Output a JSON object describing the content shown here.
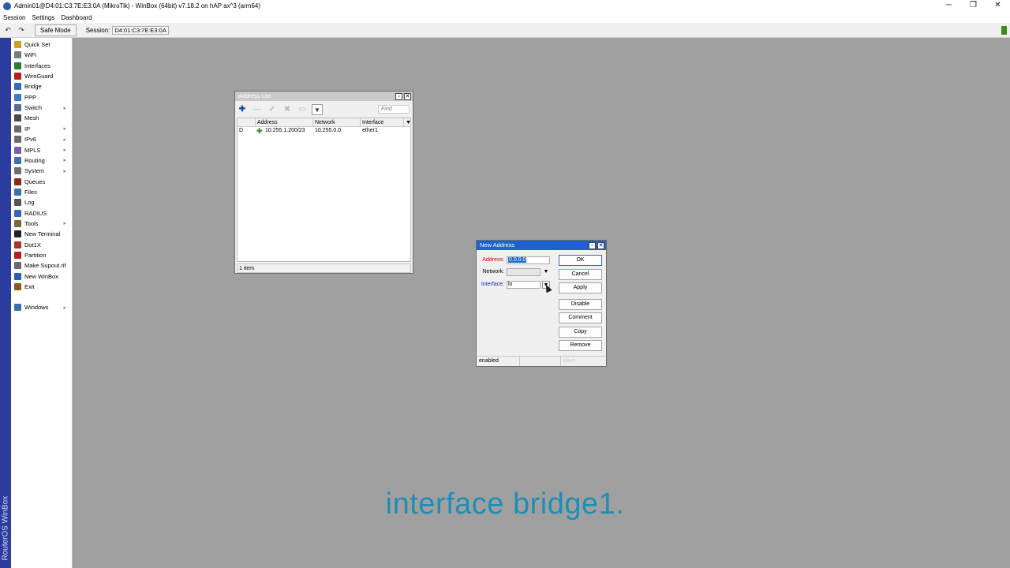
{
  "window": {
    "title": "Admin01@D4:01:C3:7E:E3:0A (MikroTik) - WinBox (64bit) v7.18.2 on hAP ax^3 (arm64)",
    "min_glyph": "─",
    "max_glyph": "❐",
    "close_glyph": "✕"
  },
  "menu": [
    "Session",
    "Settings",
    "Dashboard"
  ],
  "toolbar": {
    "undo_glyph": "↶",
    "redo_glyph": "↷",
    "safe_mode_label": "Safe Mode",
    "session_label": "Session:",
    "session_value": "D4:01:C3:7E:E3:0A"
  },
  "brand_vertical": "RouterOS WinBox",
  "sidebar": {
    "items": [
      {
        "label": "Quick Set",
        "icon": "quick-set-icon",
        "color": "#c9a227",
        "submenu": false
      },
      {
        "label": "WiFi",
        "icon": "wifi-icon",
        "color": "#7a7a7a",
        "submenu": false
      },
      {
        "label": "Interfaces",
        "icon": "interfaces-icon",
        "color": "#2e7d32",
        "submenu": false
      },
      {
        "label": "WireGuard",
        "icon": "wireguard-icon",
        "color": "#b0231a",
        "submenu": false
      },
      {
        "label": "Bridge",
        "icon": "bridge-icon",
        "color": "#2e6fb5",
        "submenu": false
      },
      {
        "label": "PPP",
        "icon": "ppp-icon",
        "color": "#3c7cc2",
        "submenu": false
      },
      {
        "label": "Switch",
        "icon": "switch-icon",
        "color": "#5a6e8a",
        "submenu": true
      },
      {
        "label": "Mesh",
        "icon": "mesh-icon",
        "color": "#4a4a4a",
        "submenu": false
      },
      {
        "label": "IP",
        "icon": "ip-icon",
        "color": "#6b6b6b",
        "submenu": true
      },
      {
        "label": "IPv6",
        "icon": "ipv6-icon",
        "color": "#6b6b6b",
        "submenu": true
      },
      {
        "label": "MPLS",
        "icon": "mpls-icon",
        "color": "#7b5ea7",
        "submenu": true
      },
      {
        "label": "Routing",
        "icon": "routing-icon",
        "color": "#3e6fae",
        "submenu": true
      },
      {
        "label": "System",
        "icon": "system-icon",
        "color": "#6e6e6e",
        "submenu": true
      },
      {
        "label": "Queues",
        "icon": "queues-icon",
        "color": "#8a2a1c",
        "submenu": false
      },
      {
        "label": "Files",
        "icon": "files-icon",
        "color": "#3a6fb0",
        "submenu": false
      },
      {
        "label": "Log",
        "icon": "log-icon",
        "color": "#555555",
        "submenu": false
      },
      {
        "label": "RADIUS",
        "icon": "radius-icon",
        "color": "#3b63b8",
        "submenu": false
      },
      {
        "label": "Tools",
        "icon": "tools-icon",
        "color": "#7a6a3a",
        "submenu": true
      },
      {
        "label": "New Terminal",
        "icon": "terminal-icon",
        "color": "#222222",
        "submenu": false
      },
      {
        "label": "Dot1X",
        "icon": "dot1x-icon",
        "color": "#b03030",
        "submenu": false
      },
      {
        "label": "Partition",
        "icon": "partition-icon",
        "color": "#b01e1e",
        "submenu": false
      },
      {
        "label": "Make Supout.rif",
        "icon": "supout-icon",
        "color": "#6a6a6a",
        "submenu": false
      },
      {
        "label": "New WinBox",
        "icon": "winbox-icon",
        "color": "#2a5ea8",
        "submenu": false
      },
      {
        "label": "Exit",
        "icon": "exit-icon",
        "color": "#8a5a1e",
        "submenu": false
      }
    ],
    "windows": {
      "label": "Windows",
      "icon": "windows-icon",
      "color": "#3a6fb0",
      "submenu": true
    }
  },
  "address_list": {
    "title": "Address List",
    "find_placeholder": "Find",
    "filter_glyph": "▼",
    "add_glyph": "✚",
    "remove_glyph": "—",
    "enable_glyph": "✔",
    "disable_glyph": "✖",
    "comment_glyph": "▭",
    "columns": [
      "Address",
      "Network",
      "Interface"
    ],
    "rows": [
      {
        "flag": "D",
        "address": "10.255.1.200/23",
        "network": "10.255.0.0",
        "interface": "ether1"
      }
    ],
    "status": "1 item"
  },
  "new_address": {
    "title": "New Address",
    "address_label": "Address:",
    "address_value": "0.0.0.0",
    "network_label": "Network:",
    "network_value": "",
    "interface_label": "Interface:",
    "interface_value": "lo",
    "buttons": [
      "OK",
      "Cancel",
      "Apply",
      "Disable",
      "Comment",
      "Copy",
      "Remove"
    ],
    "status_left": "enabled",
    "status_mid": "",
    "status_right": "slave"
  },
  "caption": "interface bridge1."
}
